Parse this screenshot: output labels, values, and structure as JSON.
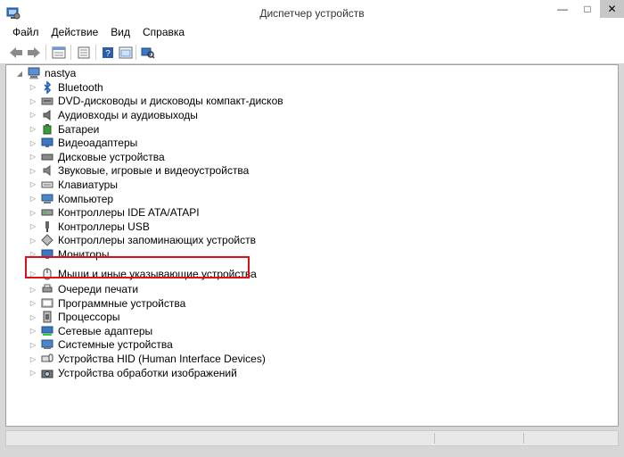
{
  "window": {
    "title": "Диспетчер устройств",
    "controls": {
      "minimize": "—",
      "maximize": "□",
      "close": "✕"
    }
  },
  "menu": {
    "items": [
      "Файл",
      "Действие",
      "Вид",
      "Справка"
    ]
  },
  "toolbar": {
    "buttons": [
      "back-icon",
      "forward-icon",
      "properties-icon",
      "list-view-icon",
      "help-icon",
      "show-hidden-icon",
      "scan-hardware-icon"
    ]
  },
  "tree": {
    "root": "nastya",
    "items": [
      {
        "label": "Bluetooth",
        "icon": "bluetooth-icon"
      },
      {
        "label": "DVD-дисководы и дисководы компакт-дисков",
        "icon": "dvd-drive-icon"
      },
      {
        "label": "Аудиовходы и аудиовыходы",
        "icon": "speaker-icon"
      },
      {
        "label": "Батареи",
        "icon": "battery-icon"
      },
      {
        "label": "Видеоадаптеры",
        "icon": "display-adapter-icon"
      },
      {
        "label": "Дисковые устройства",
        "icon": "disk-drive-icon"
      },
      {
        "label": "Звуковые, игровые и видеоустройства",
        "icon": "sound-icon"
      },
      {
        "label": "Клавиатуры",
        "icon": "keyboard-icon"
      },
      {
        "label": "Компьютер",
        "icon": "computer-icon"
      },
      {
        "label": "Контроллеры IDE ATA/ATAPI",
        "icon": "ide-controller-icon"
      },
      {
        "label": "Контроллеры USB",
        "icon": "usb-icon"
      },
      {
        "label": "Контроллеры запоминающих устройств",
        "icon": "storage-controller-icon"
      },
      {
        "label": "Мониторы",
        "icon": "monitor-icon"
      },
      {
        "label": "Мыши и иные указывающие устройства",
        "icon": "mouse-icon"
      },
      {
        "label": "Очереди печати",
        "icon": "printer-icon"
      },
      {
        "label": "Программные устройства",
        "icon": "software-device-icon"
      },
      {
        "label": "Процессоры",
        "icon": "processor-icon"
      },
      {
        "label": "Сетевые адаптеры",
        "icon": "network-adapter-icon"
      },
      {
        "label": "Системные устройства",
        "icon": "system-device-icon"
      },
      {
        "label": "Устройства HID (Human Interface Devices)",
        "icon": "hid-icon"
      },
      {
        "label": "Устройства обработки изображений",
        "icon": "imaging-device-icon"
      }
    ]
  },
  "colors": {
    "highlight": "#e0101a",
    "accent": "#2a6ab8"
  }
}
